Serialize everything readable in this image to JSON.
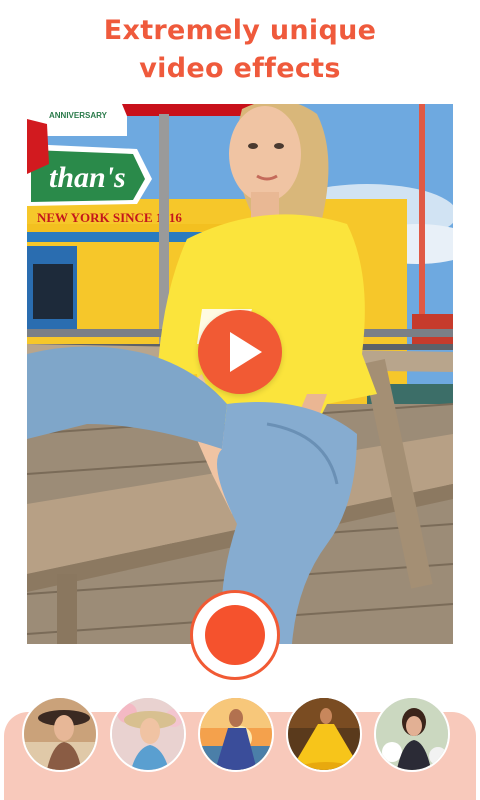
{
  "headline": {
    "line1": "Extremely unique",
    "line2": "video effects"
  },
  "colors": {
    "accent": "#f15a34",
    "tray": "#f8c9bb",
    "headline": "#ef5a3c"
  },
  "preview": {
    "sign_anniversary": "ANNIVERSARY",
    "sign_nathans": "than's",
    "sign_since": "NEW YORK SINCE 1916",
    "play_icon": "play-icon"
  },
  "record": {
    "icon": "record-icon"
  },
  "effects": [
    {
      "icon": "effect-thumbnail-1"
    },
    {
      "icon": "effect-thumbnail-2"
    },
    {
      "icon": "effect-thumbnail-3"
    },
    {
      "icon": "effect-thumbnail-4"
    },
    {
      "icon": "effect-thumbnail-5"
    }
  ]
}
